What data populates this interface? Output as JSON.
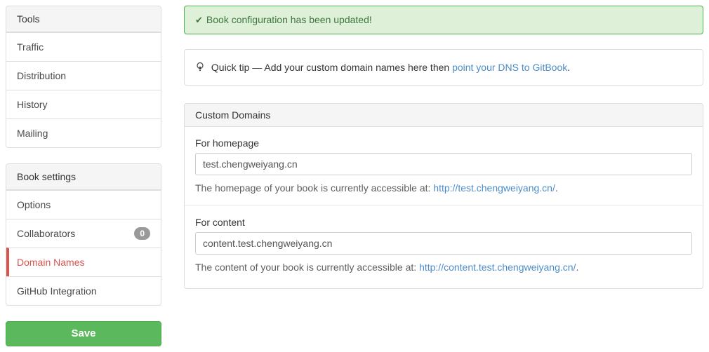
{
  "sidebar": {
    "tools": {
      "header": "Tools",
      "items": [
        {
          "label": "Traffic"
        },
        {
          "label": "Distribution"
        },
        {
          "label": "History"
        },
        {
          "label": "Mailing"
        }
      ]
    },
    "book_settings": {
      "header": "Book settings",
      "items": [
        {
          "label": "Options"
        },
        {
          "label": "Collaborators",
          "badge": "0"
        },
        {
          "label": "Domain Names",
          "active": true
        },
        {
          "label": "GitHub Integration"
        }
      ]
    },
    "save_label": "Save"
  },
  "alert": {
    "check_icon": "✔",
    "text": "Book configuration has been updated!"
  },
  "quick_tip": {
    "icon": "lightbulb-icon",
    "prefix": "Quick tip — Add your custom domain names here then",
    "link": "point your DNS to GitBook",
    "suffix": "."
  },
  "custom_domains": {
    "header": "Custom Domains",
    "homepage": {
      "label": "For homepage",
      "value": "test.chengweiyang.cn",
      "help_prefix": "The homepage of your book is currently accessible at:",
      "help_link": "http://test.chengweiyang.cn/",
      "help_suffix": "."
    },
    "content": {
      "label": "For content",
      "value": "content.test.chengweiyang.cn",
      "help_prefix": "The content of your book is currently accessible at:",
      "help_link": "http://content.test.chengweiyang.cn/",
      "help_suffix": "."
    }
  },
  "colors": {
    "success_bg": "#dff0d8",
    "success_border": "#4cae4c",
    "success_text": "#3c763d",
    "link_blue": "#4d8cc9",
    "danger_red": "#d9534f",
    "save_green": "#5cb85c",
    "badge_gray": "#999999",
    "panel_border": "#dddddd",
    "panel_header_bg": "#f5f5f5"
  }
}
